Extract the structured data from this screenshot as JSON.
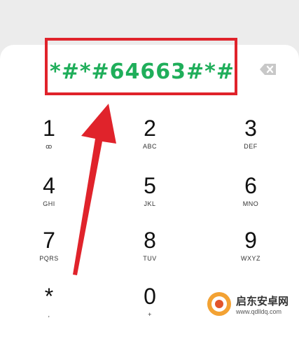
{
  "dialer": {
    "entered_number": "*#*#64663#*#",
    "keys": [
      {
        "digit": "1",
        "letters": "ꝏ"
      },
      {
        "digit": "2",
        "letters": "ABC"
      },
      {
        "digit": "3",
        "letters": "DEF"
      },
      {
        "digit": "4",
        "letters": "GHI"
      },
      {
        "digit": "5",
        "letters": "JKL"
      },
      {
        "digit": "6",
        "letters": "MNO"
      },
      {
        "digit": "7",
        "letters": "PQRS"
      },
      {
        "digit": "8",
        "letters": "TUV"
      },
      {
        "digit": "9",
        "letters": "WXYZ"
      },
      {
        "digit": "*",
        "letters": ","
      },
      {
        "digit": "0",
        "letters": "+"
      }
    ]
  },
  "annotation": {
    "box_color": "#e0232b",
    "arrow_color": "#e0232b",
    "digits_color": "#1fae5a"
  },
  "watermark": {
    "text_cn": "启东安卓网",
    "text_en": "www.qdlldq.com"
  }
}
